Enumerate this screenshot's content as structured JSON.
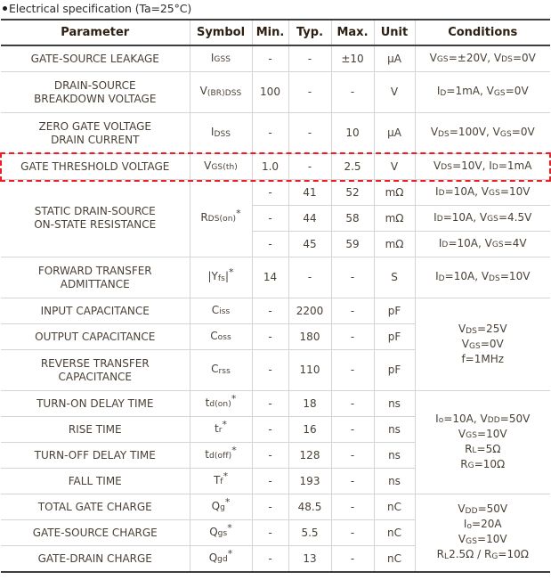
{
  "caption": "Electrical specification (Ta=25°C)",
  "table": {
    "headers": [
      "Parameter",
      "Symbol",
      "Min.",
      "Typ.",
      "Max.",
      "Unit",
      "Conditions"
    ],
    "rows": [
      {
        "parameter": "GATE-SOURCE LEAKAGE",
        "symbol_main": "I",
        "symbol_sub": "GSS",
        "symbol_tail": "",
        "symbol_star": "",
        "min": "-",
        "typ": "-",
        "max": "±10",
        "unit": "μA",
        "cond_lines": [
          "VGS=±20V, VDS=0V"
        ]
      },
      {
        "parameter": "DRAIN-SOURCE BREAKDOWN VOLTAGE",
        "symbol_main": "V",
        "symbol_sub": "(BR)DSS",
        "symbol_tail": "",
        "symbol_star": "",
        "min": "100",
        "typ": "-",
        "max": "-",
        "unit": "V",
        "cond_lines": [
          "ID=1mA, VGS=0V"
        ]
      },
      {
        "parameter": "ZERO GATE VOLTAGE DRAIN CURRENT",
        "symbol_main": "I",
        "symbol_sub": "DSS",
        "symbol_tail": "",
        "symbol_star": "",
        "min": "-",
        "typ": "-",
        "max": "10",
        "unit": "μA",
        "cond_lines": [
          "VDS=100V, VGS=0V"
        ]
      },
      {
        "parameter": "GATE THRESHOLD VOLTAGE",
        "symbol_main": "V",
        "symbol_sub": "GS(th)",
        "symbol_tail": "",
        "symbol_star": "",
        "min": "1.0",
        "typ": "-",
        "max": "2.5",
        "unit": "V",
        "cond_lines": [
          "VDS=10V, ID=1mA"
        ],
        "highlighted": true
      },
      {
        "parameter": "STATIC DRAIN-SOURCE ON-STATE RESISTANCE",
        "symbol_main": "R",
        "symbol_sub": "DS(on)",
        "symbol_tail": "",
        "symbol_star": "*",
        "sub_rows": [
          {
            "min": "-",
            "typ": "41",
            "max": "52",
            "unit": "mΩ",
            "cond": "ID=10A, VGS=10V"
          },
          {
            "min": "-",
            "typ": "44",
            "max": "58",
            "unit": "mΩ",
            "cond": "ID=10A, VGS=4.5V"
          },
          {
            "min": "-",
            "typ": "45",
            "max": "59",
            "unit": "mΩ",
            "cond": "ID=10A, VGS=4V"
          }
        ]
      },
      {
        "parameter": "FORWARD TRANSFER ADMITTANCE",
        "symbol_main": "|Y",
        "symbol_sub": "fs",
        "symbol_tail": "|",
        "symbol_star": "*",
        "min": "14",
        "typ": "-",
        "max": "-",
        "unit": "S",
        "cond_lines": [
          "ID=10A, VDS=10V"
        ]
      },
      {
        "parameter": "INPUT CAPACITANCE",
        "symbol_main": "C",
        "symbol_sub": "iss",
        "symbol_tail": "",
        "symbol_star": "",
        "min": "-",
        "typ": "2200",
        "max": "-",
        "unit": "pF"
      },
      {
        "parameter": "OUTPUT CAPACITANCE",
        "symbol_main": "C",
        "symbol_sub": "oss",
        "symbol_tail": "",
        "symbol_star": "",
        "min": "-",
        "typ": "180",
        "max": "-",
        "unit": "pF"
      },
      {
        "parameter": "REVERSE TRANSFER CAPACITANCE",
        "symbol_main": "C",
        "symbol_sub": "rss",
        "symbol_tail": "",
        "symbol_star": "",
        "min": "-",
        "typ": "110",
        "max": "-",
        "unit": "pF"
      },
      {
        "parameter": "TURN-ON DELAY TIME",
        "symbol_main": "t",
        "symbol_sub": "d(on)",
        "symbol_tail": "",
        "symbol_star": "*",
        "min": "-",
        "typ": "18",
        "max": "-",
        "unit": "ns"
      },
      {
        "parameter": "RISE TIME",
        "symbol_main": "t",
        "symbol_sub": "r",
        "symbol_tail": "",
        "symbol_star": "*",
        "min": "-",
        "typ": "16",
        "max": "-",
        "unit": "ns"
      },
      {
        "parameter": "TURN-OFF DELAY TIME",
        "symbol_main": "t",
        "symbol_sub": "d(off)",
        "symbol_tail": "",
        "symbol_star": "*",
        "min": "-",
        "typ": "128",
        "max": "-",
        "unit": "ns"
      },
      {
        "parameter": "FALL TIME",
        "symbol_main": "T",
        "symbol_sub": "f",
        "symbol_tail": "",
        "symbol_star": "*",
        "min": "-",
        "typ": "193",
        "max": "-",
        "unit": "ns"
      },
      {
        "parameter": "TOTAL GATE CHARGE",
        "symbol_main": "Q",
        "symbol_sub": "g",
        "symbol_tail": "",
        "symbol_star": "*",
        "min": "-",
        "typ": "48.5",
        "max": "-",
        "unit": "nC"
      },
      {
        "parameter": "GATE-SOURCE CHARGE",
        "symbol_main": "Q",
        "symbol_sub": "gs",
        "symbol_tail": "",
        "symbol_star": "*",
        "min": "-",
        "typ": "5.5",
        "max": "-",
        "unit": "nC"
      },
      {
        "parameter": "GATE-DRAIN CHARGE",
        "symbol_main": "Q",
        "symbol_sub": "gd",
        "symbol_tail": "",
        "symbol_star": "*",
        "min": "-",
        "typ": "13",
        "max": "-",
        "unit": "nC"
      }
    ],
    "merged_conditions": {
      "capacitance": [
        "VDS=25V",
        "VGS=0V",
        "f=1MHz"
      ],
      "switching": [
        "Io=10A, VDD=50V",
        "VGS=10V",
        "RL=5Ω",
        "RG=10Ω"
      ],
      "gate_charge": [
        "VDD=50V",
        "Io=20A",
        "VGS=10V",
        "RL2.5Ω / RG=10Ω"
      ]
    }
  },
  "colors": {
    "highlight": "#ee1c25",
    "grid": "#d4d4d4",
    "rule": "#3d3d3d",
    "text": "#4a4136"
  }
}
